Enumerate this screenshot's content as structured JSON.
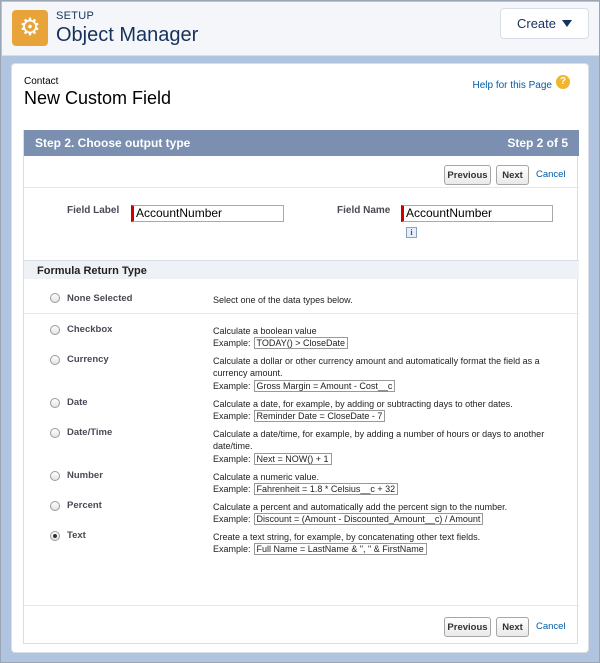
{
  "header": {
    "setup_label": "SETUP",
    "title": "Object Manager",
    "create_label": "Create"
  },
  "page": {
    "breadcrumb": "Contact",
    "title": "New Custom Field",
    "help_link": "Help for this Page"
  },
  "step": {
    "title": "Step 2. Choose output type",
    "count": "Step 2 of 5"
  },
  "buttons": {
    "previous": "Previous",
    "next": "Next",
    "cancel": "Cancel"
  },
  "fields": {
    "field_label": {
      "label": "Field Label",
      "value": "AccountNumber"
    },
    "field_name": {
      "label": "Field Name",
      "value": "AccountNumber"
    }
  },
  "formula": {
    "section_title": "Formula Return Type",
    "example_prefix": "Example:",
    "types": [
      {
        "label": "None Selected",
        "desc": "Select one of the data types below.",
        "example": "",
        "selected": false
      },
      {
        "label": "Checkbox",
        "desc": "Calculate a boolean value",
        "example": "TODAY() > CloseDate",
        "selected": false
      },
      {
        "label": "Currency",
        "desc": "Calculate a dollar or other currency amount and automatically format the field as a currency amount.",
        "example": "Gross Margin = Amount - Cost__c",
        "selected": false
      },
      {
        "label": "Date",
        "desc": "Calculate a date, for example, by adding or subtracting days to other dates.",
        "example": "Reminder Date = CloseDate - 7",
        "selected": false
      },
      {
        "label": "Date/Time",
        "desc": "Calculate a date/time, for example, by adding a number of hours or days to another date/time.",
        "example": "Next = NOW() + 1",
        "selected": false
      },
      {
        "label": "Number",
        "desc": "Calculate a numeric value.",
        "example": "Fahrenheit = 1.8 * Celsius__c + 32",
        "selected": false
      },
      {
        "label": "Percent",
        "desc": "Calculate a percent and automatically add the percent sign to the number.",
        "example": "Discount = (Amount - Discounted_Amount__c) / Amount",
        "selected": false
      },
      {
        "label": "Text",
        "desc": "Create a text string, for example, by concatenating other text fields.",
        "example": "Full Name = LastName & \", \" & FirstName",
        "selected": true
      }
    ]
  },
  "icons": {
    "setup": "gear-icon",
    "create_caret": "caret-down-icon",
    "help": "help-icon",
    "info": "info-icon"
  },
  "colors": {
    "setup_icon_bg": "#e8a33a",
    "step_header_bg": "#7b8fb1",
    "required_bar": "#cc0000",
    "link": "#015ba7"
  }
}
